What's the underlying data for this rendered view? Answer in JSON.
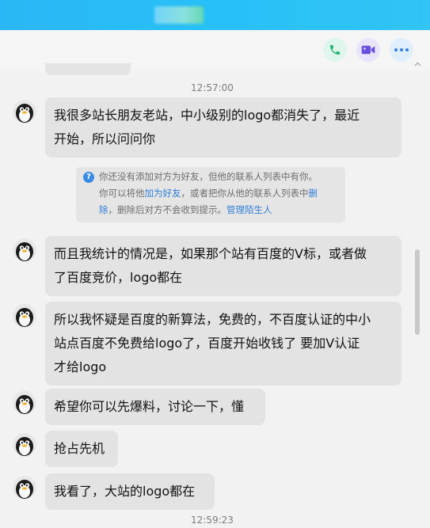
{
  "window": {
    "title": ""
  },
  "header": {
    "call_icon": "phone-icon",
    "video_icon": "video-camera-icon",
    "more_icon": "more-dots-icon",
    "close_glyph": "^"
  },
  "timestamps": [
    "12:57:00",
    "12:59:23"
  ],
  "notice": {
    "line1": "你还没有添加对方为好友，但他的联系人列表中有你。",
    "line2_pre": "你可以将他",
    "link_add": "加为好友",
    "line2_mid": "，或者把你从他的联系人列表中",
    "link_delete_1": "删",
    "link_delete_2": "除",
    "line3_mid": "，删除后对方不会收到提示。",
    "link_manage": "管理陌生人"
  },
  "messages": [
    {
      "line1": "我很多站长朋友老站，中小级别的logo都消失了，最近",
      "line2": "开始，所以问问你"
    },
    {
      "line1": "而且我统计的情况是，如果那个站有百度的V标，或者做",
      "line2": "了百度竞价，logo都在"
    },
    {
      "line1": "所以我怀疑是百度的新算法，免费的，不百度认证的中小",
      "line2": "站点百度不免费给logo了，百度开始收钱了 要加V认证",
      "line3": "才给logo"
    },
    {
      "line1": "希望你可以先爆料，讨论一下，懂"
    },
    {
      "line1": "抢占先机"
    },
    {
      "line1": "我看了，大站的logo都在"
    }
  ],
  "colors": {
    "titlebar": "#2ab7f5",
    "bubble": "#e3e3e3",
    "link": "#2f7fd8"
  }
}
